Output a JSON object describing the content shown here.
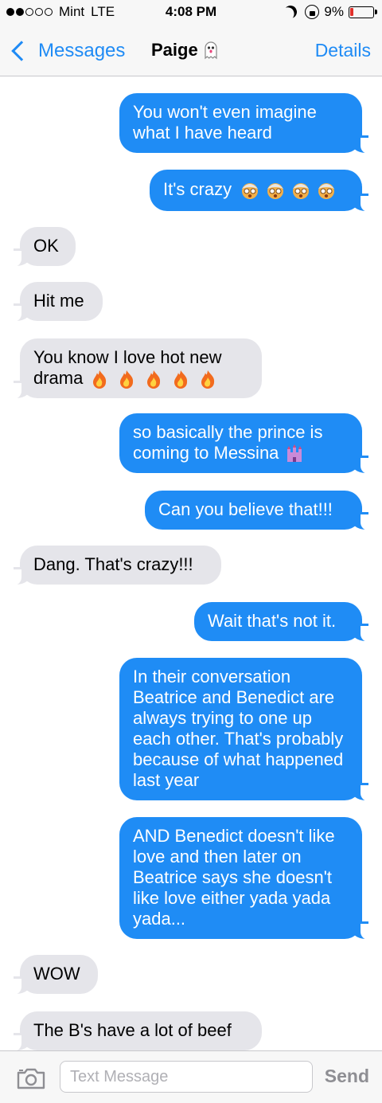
{
  "status_bar": {
    "carrier": "Mint",
    "network": "LTE",
    "time": "4:08 PM",
    "battery": "9%",
    "signal_filled": 2,
    "signal_total": 5
  },
  "nav": {
    "back_label": "Messages",
    "title": "Paige",
    "details_label": "Details",
    "accent_color": "#1f8bf5"
  },
  "messages": [
    {
      "from": "me",
      "text": "You won't even imagine what I have heard"
    },
    {
      "from": "me",
      "text": "It's crazy",
      "emoji": [
        "old-woman-emoji",
        "old-woman-emoji",
        "old-woman-emoji",
        "old-woman-emoji"
      ]
    },
    {
      "from": "them",
      "text": "OK"
    },
    {
      "from": "them",
      "text": "Hit me"
    },
    {
      "from": "them",
      "text": "You know I love hot new drama",
      "emoji": [
        "fire-emoji",
        "fire-emoji",
        "fire-emoji",
        "fire-emoji",
        "fire-emoji"
      ]
    },
    {
      "from": "me",
      "text": "so basically the prince is coming to Messina",
      "emoji": [
        "castle-emoji"
      ]
    },
    {
      "from": "me",
      "text": "Can you believe that!!!"
    },
    {
      "from": "them",
      "text": "Dang. That's crazy!!!"
    },
    {
      "from": "me",
      "text": "Wait that's not it."
    },
    {
      "from": "me",
      "text": "In their conversation Beatrice and Benedict are always trying to one up each other. That's probably because of what happened last year"
    },
    {
      "from": "me",
      "text": "AND Benedict doesn't like love and then later on Beatrice says she doesn't like love either yada yada yada..."
    },
    {
      "from": "them",
      "text": "WOW"
    },
    {
      "from": "them",
      "text": "The B's have a lot of beef"
    }
  ],
  "compose": {
    "placeholder": "Text Message",
    "send_label": "Send"
  },
  "colors": {
    "sent_bubble": "#1f8cf5",
    "received_bubble": "#e5e5ea",
    "bar_background": "#f7f7f7"
  }
}
